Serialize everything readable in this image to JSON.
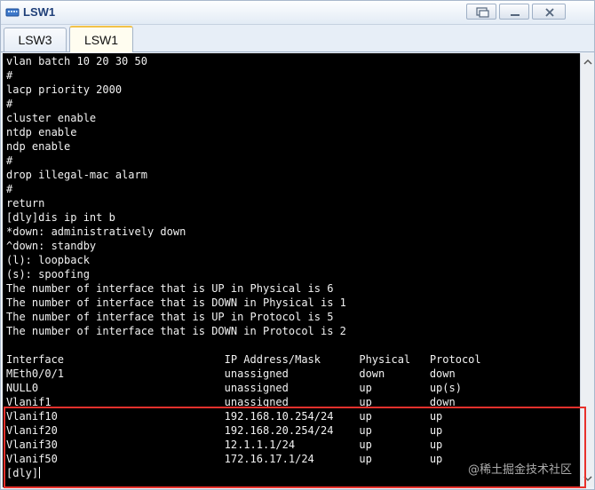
{
  "window": {
    "title": "LSW1"
  },
  "tabs": [
    {
      "label": "LSW3",
      "active": false
    },
    {
      "label": "LSW1",
      "active": true
    }
  ],
  "terminal": {
    "lines": [
      "vlan batch 10 20 30 50",
      "#",
      "lacp priority 2000",
      "#",
      "cluster enable",
      "ntdp enable",
      "ndp enable",
      "#",
      "drop illegal-mac alarm",
      "#",
      "return",
      "[dly]dis ip int b",
      "*down: administratively down",
      "^down: standby",
      "(l): loopback",
      "(s): spoofing",
      "The number of interface that is UP in Physical is 6",
      "The number of interface that is DOWN in Physical is 1",
      "The number of interface that is UP in Protocol is 5",
      "The number of interface that is DOWN in Protocol is 2",
      "",
      "Interface                         IP Address/Mask      Physical   Protocol",
      "MEth0/0/1                         unassigned           down       down",
      "NULL0                             unassigned           up         up(s)",
      "Vlanif1                           unassigned           up         down",
      "Vlanif10                          192.168.10.254/24    up         up",
      "Vlanif20                          192.168.20.254/24    up         up",
      "Vlanif30                          12.1.1.1/24          up         up",
      "Vlanif50                          172.16.17.1/24       up         up",
      "[dly]"
    ]
  },
  "watermark": "@稀土掘金技术社区",
  "colors": {
    "terminal_bg": "#000000",
    "terminal_fg": "#f2f2f2",
    "highlight": "#e8312c",
    "active_tab_accent": "#f2c24a"
  },
  "icons": {
    "app": "switch-icon",
    "restore": "restore-icon",
    "minimize": "minimize-icon",
    "close": "close-icon"
  }
}
